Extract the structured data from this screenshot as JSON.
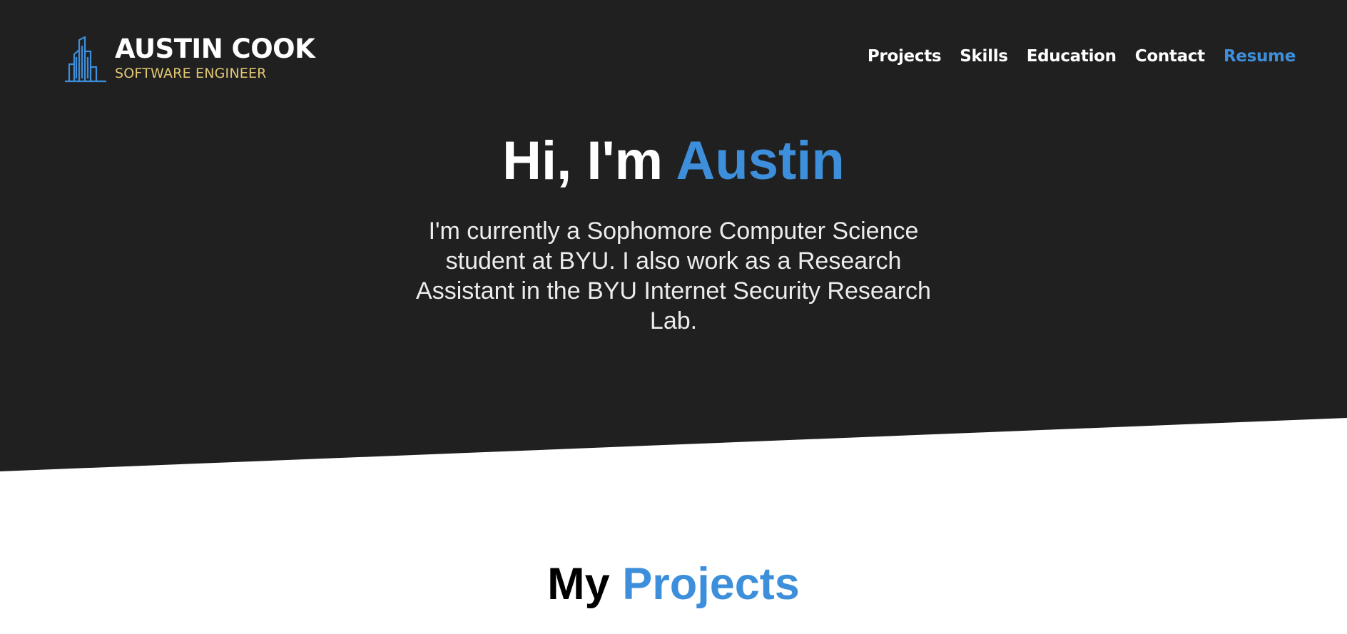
{
  "colors": {
    "hero_background": "#202020",
    "accent": "#3d8fdb",
    "logo_subtitle": "#e3c873",
    "page_background": "#ffffff"
  },
  "header": {
    "logo": {
      "icon": "city-skyline-icon",
      "name": "AUSTIN COOK",
      "title": "SOFTWARE ENGINEER"
    },
    "nav": [
      {
        "label": "Projects"
      },
      {
        "label": "Skills"
      },
      {
        "label": "Education"
      },
      {
        "label": "Contact"
      },
      {
        "label": "Resume"
      }
    ]
  },
  "hero": {
    "greeting": "Hi, I'm ",
    "name": "Austin",
    "description": "I'm currently a Sophomore Computer Science student at BYU. I also work as a Research Assistant in the BYU Internet Security Research Lab."
  },
  "projects_section": {
    "title_prefix": "My ",
    "title_highlight": "Projects"
  }
}
